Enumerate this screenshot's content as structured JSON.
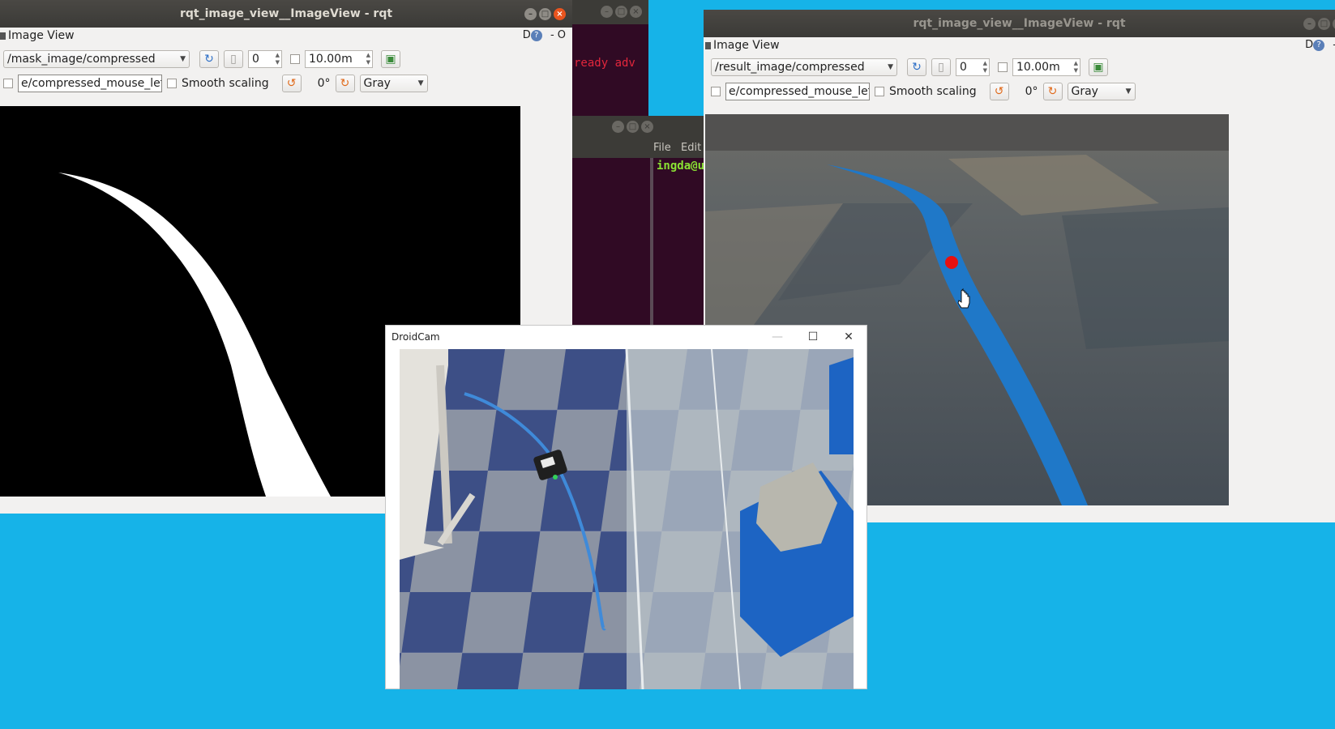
{
  "left_window": {
    "title": "rqt_image_view__ImageView - rqt",
    "panel_title": "Image View",
    "dock_letter": "D",
    "dock_help": "?",
    "dock_close_glyph": "- O",
    "topic": "/mask_image/compressed",
    "spin_value": "0",
    "distance": "10.00m",
    "mouse_topic": "e/compressed_mouse_left",
    "smooth_label": "Smooth scaling",
    "rotation": "0°",
    "color_mode": "Gray"
  },
  "right_window": {
    "title": "rqt_image_view__ImageView - rqt",
    "panel_title": "Image View",
    "dock_letter": "D",
    "dock_help": "?",
    "dock_close_glyph": "-",
    "topic": "/result_image/compressed",
    "spin_value": "0",
    "distance": "10.00m",
    "mouse_topic": "e/compressed_mouse_left",
    "smooth_label": "Smooth scaling",
    "rotation": "0°",
    "color_mode": "Gray"
  },
  "terminal_back": {
    "text": "ready adv"
  },
  "terminal_front": {
    "menu_file": "File",
    "menu_edit": "Edit",
    "prompt": "ingda@u"
  },
  "droidcam": {
    "title": "DroidCam",
    "minimize": "—",
    "maximize": "☐",
    "close": "✕"
  },
  "colors": {
    "desktop": "#16b3e8",
    "line_blue": "#1f78c8",
    "target_red": "#e81010",
    "term_bg": "#300a24",
    "titlebar": "#3c3b37"
  }
}
